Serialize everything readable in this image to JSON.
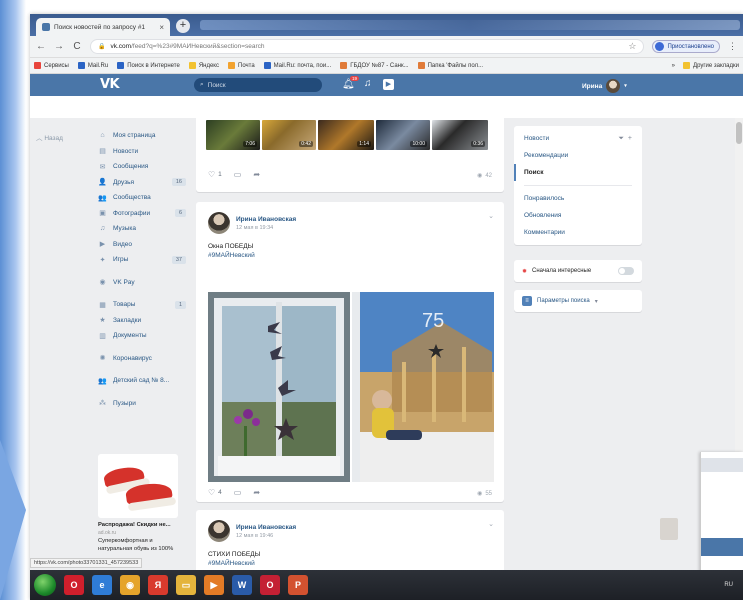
{
  "browser": {
    "tab_title": "Поиск новостей по запросу #1",
    "tab_close": "×",
    "new_tab": "+",
    "url_domain": "vk.com",
    "url_path": "/feed?q=%23#9МАЙНевский&section=search",
    "star": "☆",
    "profile_label": "Приостановлено",
    "menu": "⋮",
    "nav_back": "←",
    "nav_forward": "→",
    "nav_reload": "C",
    "nav_lock": "🔒",
    "bookmarks": [
      {
        "label": "Сервисы",
        "color": "#e8453c"
      },
      {
        "label": "Mail.Ru",
        "color": "#2b64c5"
      },
      {
        "label": "Поиск в Интернете",
        "color": "#2b64c5"
      },
      {
        "label": "Яндекс",
        "color": "#f2c230"
      },
      {
        "label": "Почта",
        "color": "#f2a32f"
      },
      {
        "label": "Mail.Ru: почта, пои...",
        "color": "#2b64c5"
      },
      {
        "label": "ГБДОУ №87 - Санк...",
        "color": "#e07b39"
      },
      {
        "label": "Папка 'Файлы пол...",
        "color": "#e07b39"
      }
    ],
    "bookmarks_more": "»",
    "other_bookmarks": "Другие закладки"
  },
  "vk": {
    "logo": "VK",
    "search_placeholder": "Поиск",
    "notifications_badge": "19",
    "user_name": "Ирина",
    "back_label": "Назад",
    "nav": [
      {
        "icon": "home-icon",
        "glyph": "⌂",
        "label": "Моя страница",
        "count": ""
      },
      {
        "icon": "news-icon",
        "glyph": "▤",
        "label": "Новости",
        "count": ""
      },
      {
        "icon": "messages-icon",
        "glyph": "✉",
        "label": "Сообщения",
        "count": ""
      },
      {
        "icon": "friends-icon",
        "glyph": "👤",
        "label": "Друзья",
        "count": "16"
      },
      {
        "icon": "communities-icon",
        "glyph": "👥",
        "label": "Сообщества",
        "count": ""
      },
      {
        "icon": "photos-icon",
        "glyph": "▣",
        "label": "Фотографии",
        "count": "6"
      },
      {
        "icon": "music-icon",
        "glyph": "♫",
        "label": "Музыка",
        "count": ""
      },
      {
        "icon": "video-icon",
        "glyph": "▶",
        "label": "Видео",
        "count": ""
      },
      {
        "icon": "games-icon",
        "glyph": "✦",
        "label": "Игры",
        "count": "37"
      }
    ],
    "nav2": [
      {
        "icon": "vkpay-icon",
        "glyph": "◉",
        "label": "VK Pay",
        "count": ""
      }
    ],
    "nav3": [
      {
        "icon": "goods-icon",
        "glyph": "▦",
        "label": "Товары",
        "count": "1"
      },
      {
        "icon": "bookmarks-icon",
        "glyph": "★",
        "label": "Закладки",
        "count": ""
      },
      {
        "icon": "docs-icon",
        "glyph": "▥",
        "label": "Документы",
        "count": ""
      }
    ],
    "nav4": [
      {
        "icon": "virus-icon",
        "glyph": "✺",
        "label": "Коронавирус",
        "count": ""
      }
    ],
    "nav5": [
      {
        "icon": "group-icon",
        "glyph": "👥",
        "label": "Детский сад № 8...",
        "count": ""
      }
    ],
    "nav6": [
      {
        "icon": "bubbles-icon",
        "glyph": "⁂",
        "label": "Пузыри",
        "count": ""
      }
    ],
    "ad": {
      "title": "Распродажа! Скидки не...",
      "domain": "ad.ok.ru",
      "text": "Суперкомфортная и натуральная обувь из 100%"
    },
    "post0": {
      "thumb_durations": [
        "7:06",
        "0:42",
        "1:14",
        "10:00",
        "0:36"
      ],
      "likes": "1",
      "views": "42"
    },
    "post1": {
      "author": "Ирина Ивановская",
      "date": "12 мая в 19:34",
      "text": "Окна ПОБЕДЫ",
      "hashtag": "#9МАЙНевский",
      "likes": "4",
      "views": "55"
    },
    "post2": {
      "author": "Ирина Ивановская",
      "date": "12 мая в 19:46",
      "text": "СТИХИ ПОБЕДЫ",
      "hashtag": "#9МАЙНевский"
    },
    "right_menu": {
      "news": "Новости",
      "recommendations": "Рекомендации",
      "search": "Поиск",
      "liked": "Понравилось",
      "updates": "Обновления",
      "comments": "Комментарии"
    },
    "interesting_first": "Сначала интересные",
    "search_params": "Параметры поиска",
    "search_params_arrow": "▾"
  },
  "status_url": "https://vk.com/photo33701331_457239533",
  "taskbar": {
    "apps": [
      {
        "name": "opera-icon",
        "color": "#d01f2c",
        "glyph": "O"
      },
      {
        "name": "ie-icon",
        "color": "#2f7cd6",
        "glyph": "e"
      },
      {
        "name": "chrome-icon",
        "color": "#e5a42b",
        "glyph": "◉"
      },
      {
        "name": "yandex-icon",
        "color": "#d83a2d",
        "glyph": "Я"
      },
      {
        "name": "explorer-icon",
        "color": "#e4b43c",
        "glyph": "▭"
      },
      {
        "name": "media-icon",
        "color": "#e37b26",
        "glyph": "▶"
      },
      {
        "name": "word-icon",
        "color": "#2a5ba8",
        "glyph": "W"
      },
      {
        "name": "opera2-icon",
        "color": "#c42034",
        "glyph": "O"
      },
      {
        "name": "powerpoint-icon",
        "color": "#d35230",
        "glyph": "P"
      }
    ],
    "tray": "RU"
  }
}
